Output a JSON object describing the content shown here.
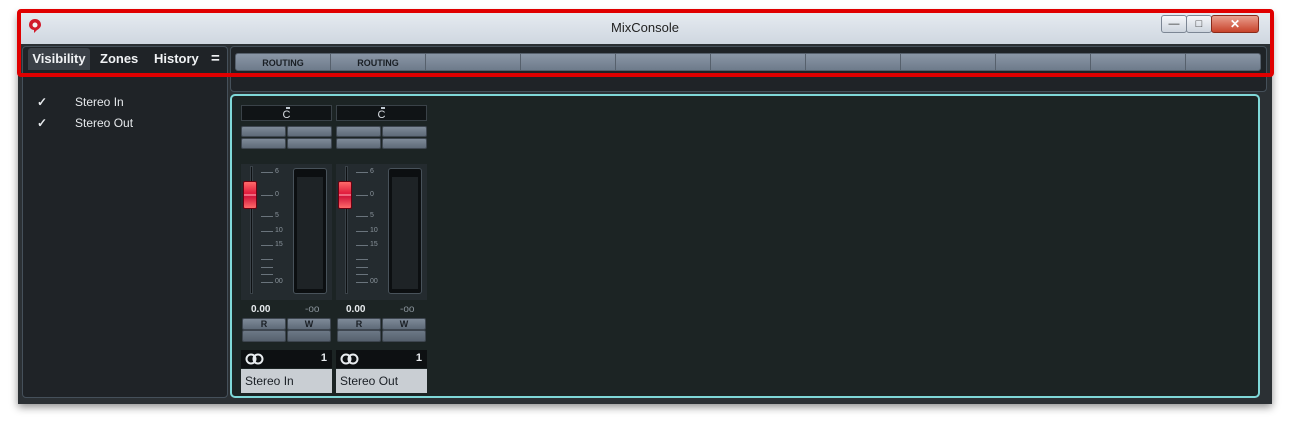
{
  "window": {
    "title": "MixConsole",
    "controls": {
      "minimize": "—",
      "maximize": "□",
      "close": "✕"
    }
  },
  "left_panel": {
    "tabs": [
      {
        "label": "Visibility",
        "active": true
      },
      {
        "label": "Zones",
        "active": false
      },
      {
        "label": "History",
        "active": false
      }
    ],
    "menu_glyph": "=",
    "visibility_items": [
      {
        "checked": "✓",
        "label": "Stereo In"
      },
      {
        "checked": "✓",
        "label": "Stereo Out"
      }
    ]
  },
  "routing": {
    "cells": [
      "ROUTING",
      "ROUTING",
      "",
      "",
      "",
      "",
      "",
      "",
      "",
      "",
      ""
    ]
  },
  "fader_scale": [
    "6",
    "0",
    "5",
    "10",
    "15",
    "00"
  ],
  "channels": [
    {
      "pan": "C",
      "volume": "0.00",
      "peak": "-oo",
      "read": "R",
      "write": "W",
      "link_icon": "stereo-link-icon",
      "io_number": "1",
      "name": "Stereo In"
    },
    {
      "pan": "C",
      "volume": "0.00",
      "peak": "-oo",
      "read": "R",
      "write": "W",
      "link_icon": "stereo-link-icon",
      "io_number": "1",
      "name": "Stereo Out"
    }
  ],
  "colors": {
    "highlight": "#e00000",
    "accent": "#7fd8d8",
    "fader": "#e01a3c"
  }
}
